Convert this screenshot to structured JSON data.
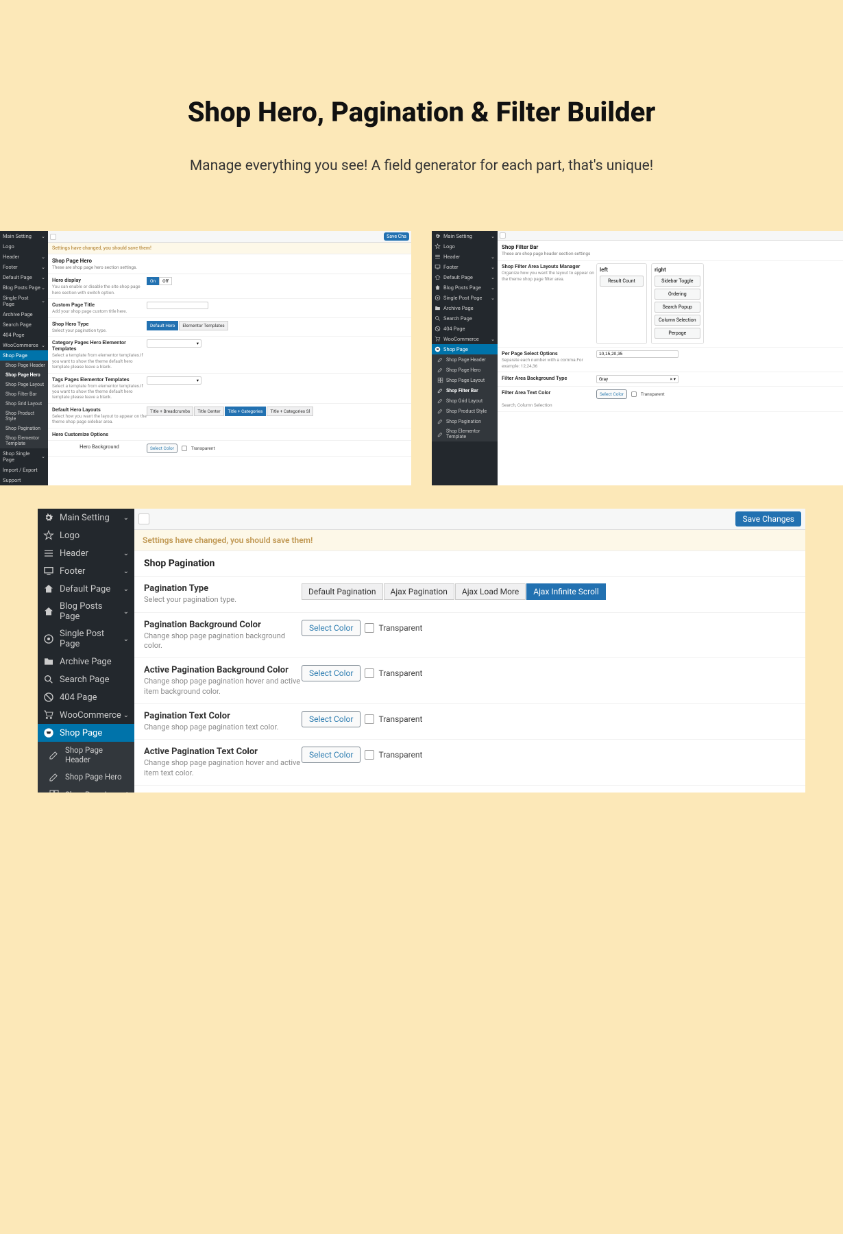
{
  "hero": {
    "title": "Shop Hero, Pagination & Filter Builder",
    "subtitle": "Manage everything you see! A field generator for each part, that's unique!"
  },
  "icons": {
    "gear": "gear",
    "star": "star",
    "hamburger": "hamburger",
    "monitor": "monitor",
    "home": "home",
    "homefill": "homefill",
    "target": "target",
    "folder": "folder",
    "search": "search",
    "ban": "ban",
    "cart": "cart",
    "cartcircle": "cartcircle",
    "pencil": "pencil",
    "grid": "grid"
  },
  "sidebar_common": {
    "main": "Main Setting",
    "logo": "Logo",
    "header": "Header",
    "footer": "Footer",
    "default_page": "Default Page",
    "blog_posts": "Blog Posts Page",
    "single_post": "Single Post Page",
    "archive": "Archive Page",
    "search": "Search Page",
    "p404": "404 Page",
    "woo": "WooCommerce",
    "shop": "Shop Page",
    "sp_header": "Shop Page Header",
    "sp_hero": "Shop Page Hero",
    "sp_layout": "Shop Page Layout",
    "sp_filter": "Shop Filter Bar",
    "sp_grid": "Shop Grid Layout",
    "sp_product": "Shop Product Style",
    "sp_pag": "Shop Pagination",
    "sp_elem": "Shop Elementor Template",
    "shop_single": "Shop Single Page",
    "import": "Import / Export",
    "support": "Support"
  },
  "buttons": {
    "save_changes": "Save Changes",
    "save_short": "Save Cha",
    "select_color": "Select Color",
    "transparent": "Transparent"
  },
  "notice": "Settings have changed, you should save them!",
  "panelA": {
    "title": "Shop Page Hero",
    "desc": "These are shop page hero section settings.",
    "f_display": {
      "t": "Hero display",
      "d": "You can enable or disable the site shop page hero section with switch option.",
      "on": "On",
      "off": "Off"
    },
    "f_title": {
      "t": "Custom Page Title",
      "d": "Add your shop page custom title here."
    },
    "f_type": {
      "t": "Shop Hero Type",
      "d": "Select your pagination type.",
      "b1": "Default Hero",
      "b2": "Elementor Templates"
    },
    "f_cat": {
      "t": "Category Pages Hero Elementor Templates",
      "d": "Select a template from elementor templates.If you want to show the theme default hero template please leave a blank."
    },
    "f_tag": {
      "t": "Tags Pages Elementor Templates",
      "d": "Select a template from elementor templates.If you want to show the theme default hero template please leave a blank."
    },
    "f_lay": {
      "t": "Default Hero Layouts",
      "d": "Select how you want the layout to appear on the theme shop page sidebar area.",
      "b1": "Title + Breadcrumbs",
      "b2": "Title Center",
      "b3": "Title + Categories",
      "b4": "Title + Categories Sl"
    },
    "f_cust": {
      "t": "Hero Customize Options"
    },
    "f_bg": {
      "t": "Hero Background"
    }
  },
  "panelB": {
    "title": "Shop Filter Bar",
    "desc": "These are shop page header section settings",
    "f_lay": {
      "t": "Shop Filter Area Layouts Manager",
      "d": "Organize how you want the layout to appear on the theme shop page filter area."
    },
    "left_h": "left",
    "right_h": "right",
    "left_items": [
      "Result Count"
    ],
    "right_items": [
      "Sidebar Toggle",
      "Ordering",
      "Search Popup",
      "Column Selection",
      "Perpage"
    ],
    "f_pp": {
      "t": "Per Page Select Options",
      "d": "Separate each number with a comma.For example: 12,24,36",
      "val": "10,15,20,35"
    },
    "f_bg": {
      "t": "Filter Area Background Type",
      "val": "Gray"
    },
    "f_tc": {
      "t": "Filter Area Text Color"
    },
    "f_note": "Search, Column Selection"
  },
  "panelC": {
    "title": "Shop Pagination",
    "f_type": {
      "t": "Pagination Type",
      "d": "Select your pagination type.",
      "b1": "Default Pagination",
      "b2": "Ajax Pagination",
      "b3": "Ajax Load More",
      "b4": "Ajax Infinite Scroll"
    },
    "f_bg": {
      "t": "Pagination Background Color",
      "d": "Change shop page pagination background color."
    },
    "f_abg": {
      "t": "Active Pagination Background Color",
      "d": "Change shop page pagination hover and active item background color."
    },
    "f_tc": {
      "t": "Pagination Text Color",
      "d": "Change shop page pagination text color."
    },
    "f_atc": {
      "t": "Active Pagination Text Color",
      "d": "Change shop page pagination hover and active item text color."
    }
  }
}
